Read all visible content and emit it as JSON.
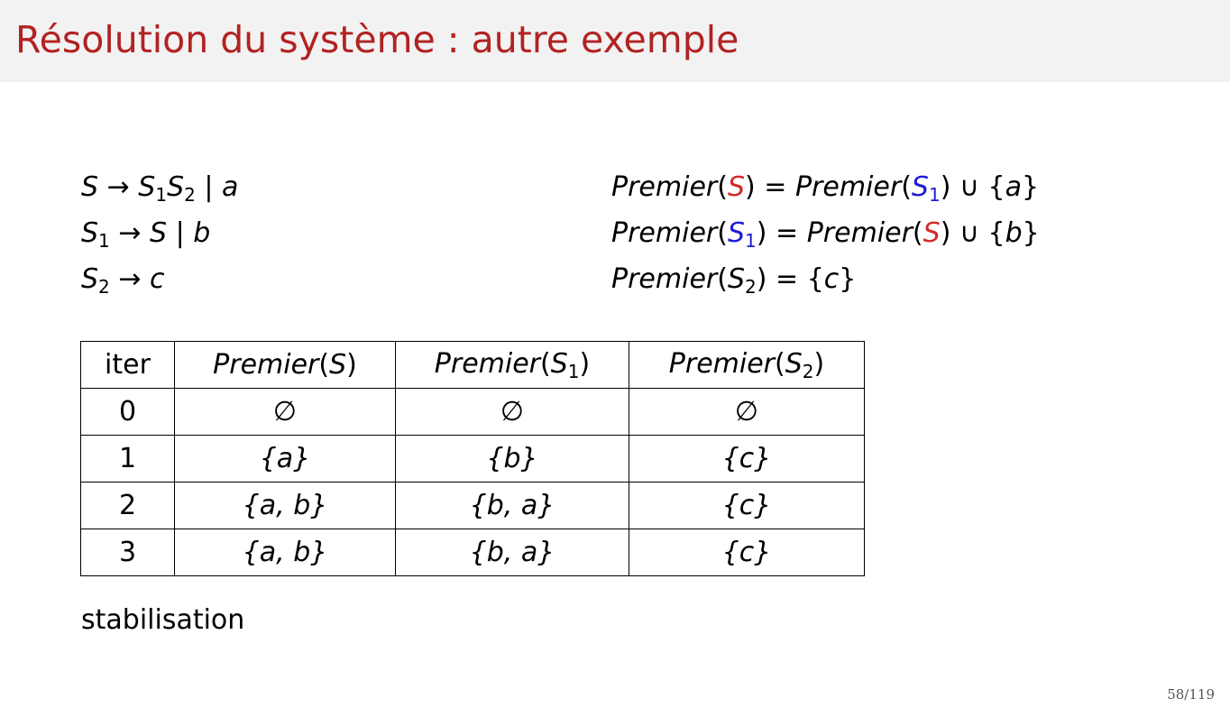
{
  "title": "Résolution du système : autre exemple",
  "symbols": {
    "arrow": "→",
    "bar": "|",
    "eq": "=",
    "union": "∪",
    "lbrace": "{",
    "rbrace": "}",
    "lparen": "(",
    "rparen": ")",
    "S": "S",
    "one": "1",
    "two": "2",
    "a": "a",
    "b": "b",
    "c": "c",
    "premier": "Premier"
  },
  "colors": {
    "title": "#b22222",
    "highlight_S": "#d22a2a",
    "highlight_S1": "#1b1bd9"
  },
  "table": {
    "headers": [
      "iter",
      "Premier(S)",
      "Premier(S1)",
      "Premier(S2)"
    ],
    "rows": [
      [
        "0",
        "∅",
        "∅",
        "∅"
      ],
      [
        "1",
        "{a}",
        "{b}",
        "{c}"
      ],
      [
        "2",
        "{a, b}",
        "{b, a}",
        "{c}"
      ],
      [
        "3",
        "{a, b}",
        "{b, a}",
        "{c}"
      ]
    ]
  },
  "conclusion": "stabilisation",
  "page_number": "58/119"
}
